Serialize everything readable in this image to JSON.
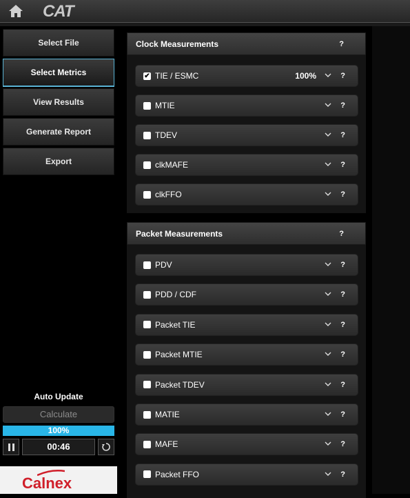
{
  "topbar": {
    "logo": "CAT"
  },
  "nav": [
    {
      "label": "Select File",
      "active": false
    },
    {
      "label": "Select Metrics",
      "active": true
    },
    {
      "label": "View Results",
      "active": false
    },
    {
      "label": "Generate Report",
      "active": false
    },
    {
      "label": "Export",
      "active": false
    }
  ],
  "auto_update": {
    "title": "Auto Update",
    "calculate_label": "Calculate",
    "progress_text": "100%",
    "progress": 1.0,
    "timer": "00:46"
  },
  "brand": {
    "name": "Calnex"
  },
  "clock": {
    "title": "Clock Measurements",
    "help": "?",
    "items": [
      {
        "label": "TIE / ESMC",
        "checked": true,
        "pct": "100%"
      },
      {
        "label": "MTIE",
        "checked": false
      },
      {
        "label": "TDEV",
        "checked": false
      },
      {
        "label": "clkMAFE",
        "checked": false
      },
      {
        "label": "clkFFO",
        "checked": false
      }
    ]
  },
  "packet": {
    "title": "Packet Measurements",
    "help": "?",
    "items": [
      {
        "label": "PDV",
        "checked": false
      },
      {
        "label": "PDD / CDF",
        "checked": false
      },
      {
        "label": "Packet TIE",
        "checked": false
      },
      {
        "label": "Packet MTIE",
        "checked": false
      },
      {
        "label": "Packet TDEV",
        "checked": false
      },
      {
        "label": "MATIE",
        "checked": false
      },
      {
        "label": "MAFE",
        "checked": false
      },
      {
        "label": "Packet FFO",
        "checked": false
      }
    ]
  },
  "colors": {
    "accent": "#29b6e8",
    "brand_red": "#d01f2a"
  }
}
